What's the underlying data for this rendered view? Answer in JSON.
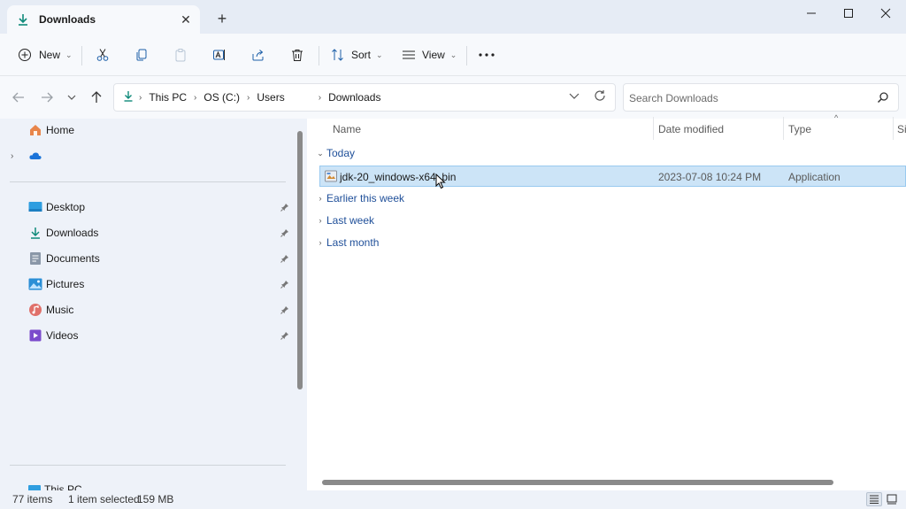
{
  "window": {
    "tab_title": "Downloads",
    "new_tab": "+"
  },
  "toolbar": {
    "new_label": "New",
    "sort_label": "Sort",
    "view_label": "View"
  },
  "address": {
    "crumbs": [
      "This PC",
      "OS (C:)",
      "Users",
      "Downloads"
    ]
  },
  "search": {
    "placeholder": "Search Downloads"
  },
  "sidebar": {
    "home": "Home",
    "quick_access": [
      "Desktop",
      "Downloads",
      "Documents",
      "Pictures",
      "Music",
      "Videos"
    ],
    "partially_visible_item": "This PC"
  },
  "columns": {
    "name": "Name",
    "date": "Date modified",
    "type": "Type",
    "size": "Si"
  },
  "groups": {
    "today": "Today",
    "earlier": "Earlier this week",
    "last_week": "Last week",
    "last_month": "Last month"
  },
  "files": [
    {
      "name": "jdk-20_windows-x64_bin",
      "date": "2023-07-08 10:24 PM",
      "type": "Application"
    }
  ],
  "statusbar": {
    "items": "77 items",
    "selected": "1 item selected",
    "size": "159 MB"
  },
  "colors": {
    "accent": "#0f8a7a",
    "group_text": "#1f4f99",
    "selection": "#cce4f7"
  }
}
